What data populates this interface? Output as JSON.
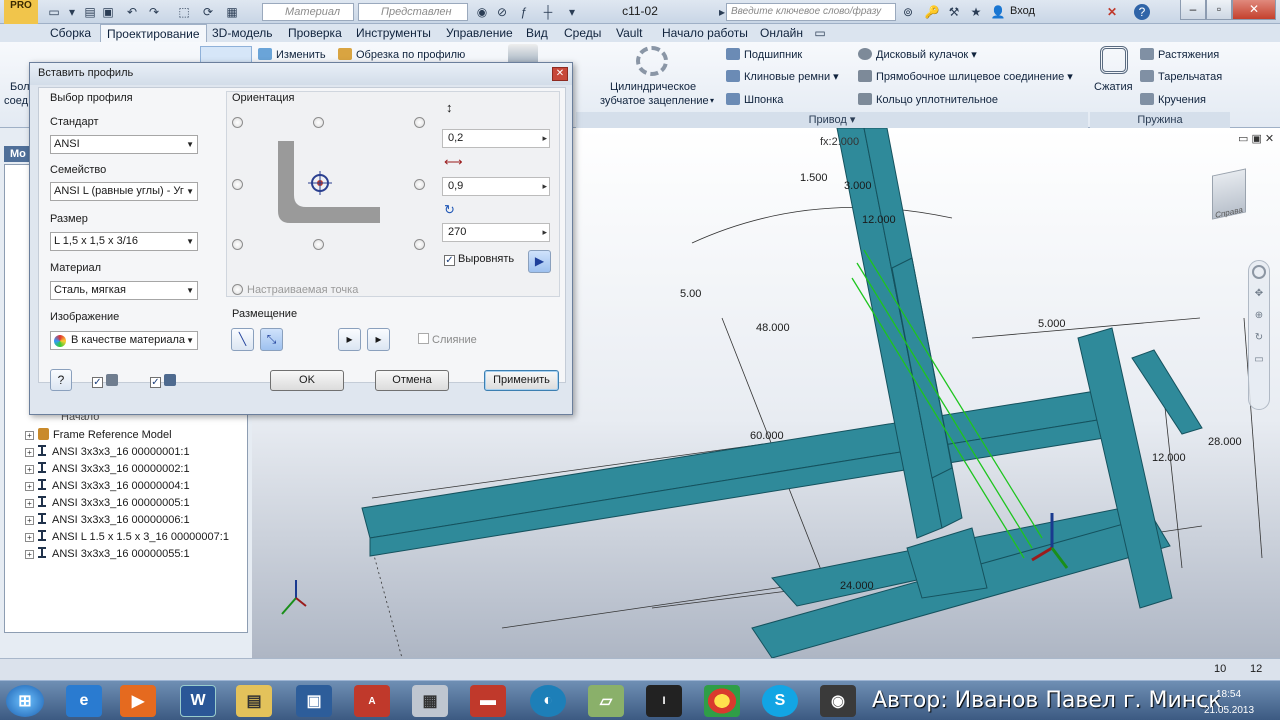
{
  "window": {
    "document_title": "c11-02",
    "material_combo": "Материал",
    "appearance_combo": "Представлен",
    "search_placeholder": "Введите ключевое слово/фразу",
    "sign_in": "Вход"
  },
  "menu_tabs": [
    "Сборка",
    "Проектирование",
    "3D-модель",
    "Проверка",
    "Инструменты",
    "Управление",
    "Вид",
    "Среды",
    "Vault",
    "Начало работы",
    "Онлайн"
  ],
  "ribbon": {
    "left_partial": [
      "Бол",
      "соед"
    ],
    "change_label": "Изменить",
    "trim_label": "Обрезка по профилю",
    "spur_gear": [
      "Цилиндрическое",
      "зубчатое зацепление"
    ],
    "drive_items": [
      "Подшипник",
      "Клиновые ремни",
      "Шпонка"
    ],
    "drive_items2": [
      "Дисковый кулачок",
      "Прямобочное шлицевое соединение",
      "Кольцо уплотнительное"
    ],
    "drive_group": "Привод",
    "spring_compress": "Сжатия",
    "spring_items": [
      "Растяжения",
      "Тарельчатая",
      "Кручения"
    ],
    "spring_group": "Пружина"
  },
  "browser": {
    "tab_partial": "Мо",
    "start_item": "Начало",
    "items": [
      "Frame Reference Model",
      "ANSI 3x3x3_16 00000001:1",
      "ANSI 3x3x3_16 00000002:1",
      "ANSI 3x3x3_16 00000004:1",
      "ANSI 3x3x3_16 00000005:1",
      "ANSI 3x3x3_16 00000006:1",
      "ANSI L 1.5 x 1.5 x 3_16 00000007:1",
      "ANSI 3x3x3_16 00000055:1"
    ]
  },
  "dialog": {
    "title": "Вставить профиль",
    "profile_section": "Выбор профиля",
    "standard_label": "Стандарт",
    "standard_value": "ANSI",
    "family_label": "Семейство",
    "family_value": "ANSI L (равные углы) - Угс",
    "size_label": "Размер",
    "size_value": "L 1,5 x 1,5 x 3/16",
    "material_label": "Материал",
    "material_value": "Сталь, мягкая",
    "appearance_label": "Изображение",
    "appearance_value": "В качестве материала",
    "orientation_section": "Ориентация",
    "offset_vertical": "0,2",
    "offset_horizontal": "0,9",
    "rotation": "270",
    "align_label": "Выровнять",
    "custom_point_label": "Настраиваемая точка",
    "placement_section": "Размещение",
    "merge_label": "Слияние",
    "ok": "OK",
    "cancel": "Отмена",
    "apply": "Применить"
  },
  "viewport": {
    "dimensions": [
      "fx:2.000",
      "1.500",
      "3.000",
      "12.000",
      "5.00",
      "48.000",
      "5.000",
      "60.000",
      "12.000",
      "28.000",
      "24.000"
    ],
    "viewcube_label": "Справа"
  },
  "status": {
    "left_num": "10",
    "right_num": "12"
  },
  "taskbar": {
    "watermark": "Автор: Иванов Павел г. Минск",
    "time": "18:54",
    "date": "21.05.2013"
  }
}
